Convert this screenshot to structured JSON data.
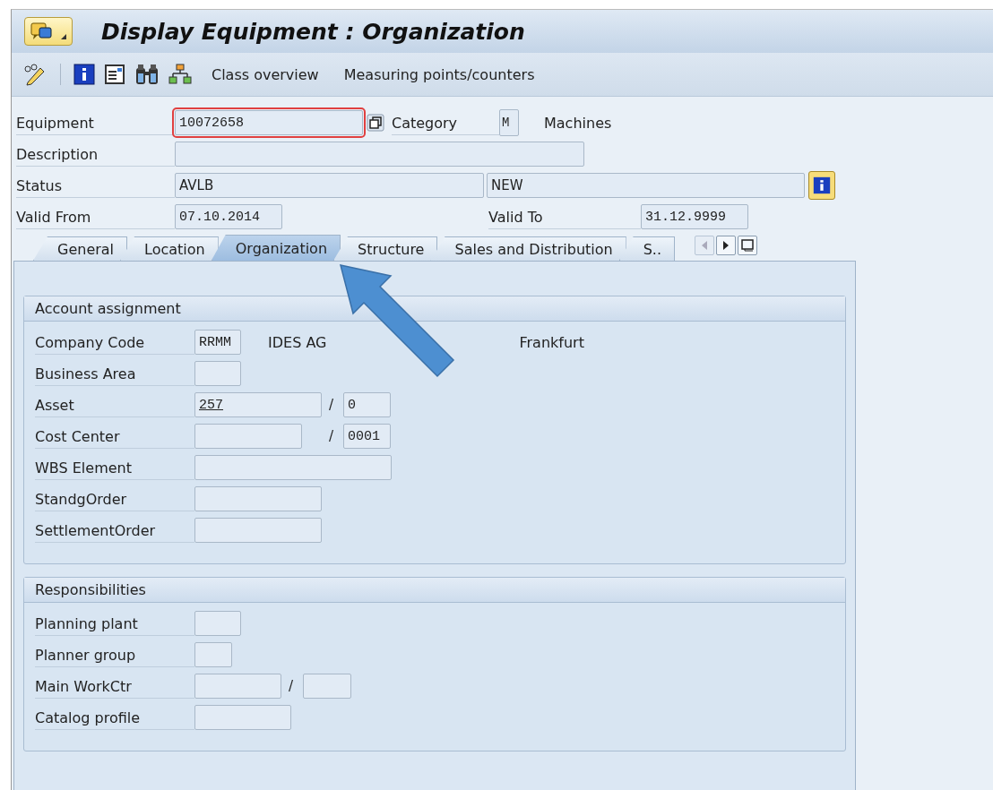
{
  "window": {
    "title": "Display Equipment : Organization"
  },
  "toolbar": {
    "buttons": [
      {
        "label": "Class overview"
      },
      {
        "label": "Measuring points/counters"
      }
    ]
  },
  "header": {
    "equipment": {
      "label": "Equipment",
      "value": "10072658",
      "focused": true
    },
    "category": {
      "label": "Category",
      "value": "M",
      "text": "Machines"
    },
    "description": {
      "label": "Description"
    },
    "status": {
      "label": "Status",
      "value": "AVLB",
      "value_2": "NEW"
    },
    "valid_from": {
      "label": "Valid From",
      "value": "07.10.2014"
    },
    "valid_to": {
      "label": "Valid To",
      "value": "31.12.9999"
    }
  },
  "tabs": [
    {
      "label": "General",
      "selected": false
    },
    {
      "label": "Location",
      "selected": false
    },
    {
      "label": "Organization",
      "selected": true
    },
    {
      "label": "Structure",
      "selected": false
    },
    {
      "label": "Sales and Distribution",
      "selected": false
    },
    {
      "label": "S..",
      "selected": false
    }
  ],
  "tab_scroll": {
    "left_disabled": true,
    "right_disabled": false
  },
  "groups": [
    {
      "title": "Account assignment",
      "rows": [
        {
          "label": "Company Code",
          "fields": [
            {
              "value": "RRMM",
              "disabled": true
            }
          ],
          "texts": [
            "IDES AG",
            "Frankfurt"
          ]
        },
        {
          "label": "Business Area",
          "fields": [
            {
              "disabled": true
            }
          ]
        },
        {
          "label": "Asset",
          "fields": [
            {
              "value": "257",
              "underlined": true,
              "disabled": true
            },
            {
              "value": "0",
              "disabled": true
            }
          ],
          "separator": "/"
        },
        {
          "label": "Cost Center",
          "fields": [
            {
              "disabled": true
            },
            {
              "value": "0001",
              "disabled": true
            }
          ],
          "separator": "/"
        },
        {
          "label": "WBS Element",
          "fields": [
            {
              "disabled": true
            }
          ]
        },
        {
          "label": "StandgOrder",
          "fields": [
            {
              "disabled": true
            }
          ]
        },
        {
          "label": "SettlementOrder",
          "fields": [
            {
              "disabled": true
            }
          ]
        }
      ]
    },
    {
      "title": "Responsibilities",
      "rows": [
        {
          "label": "Planning plant",
          "fields": [
            {
              "disabled": true
            }
          ]
        },
        {
          "label": "Planner group",
          "fields": [
            {
              "disabled": true
            }
          ]
        },
        {
          "label": "Main WorkCtr",
          "fields": [
            {
              "disabled": true
            },
            {
              "disabled": true
            }
          ],
          "separator": "/"
        },
        {
          "label": "Catalog profile",
          "fields": [
            {
              "disabled": true
            }
          ]
        }
      ]
    }
  ]
}
